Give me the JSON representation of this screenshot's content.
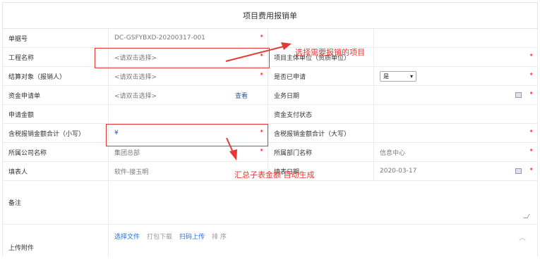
{
  "title": "项目费用报销单",
  "rows": [
    {
      "label": "单据号",
      "value": "DC-GSFYBXD-20200317-001",
      "req": true,
      "label2": "",
      "value2": "",
      "req2": false
    },
    {
      "label": "工程名称",
      "value": "<请双击选择>",
      "req": true,
      "label2": "项目主体单位（资质单位）",
      "value2": "",
      "req2": true
    },
    {
      "label": "结算对象（报销人）",
      "value": "<请双击选择>",
      "req": true,
      "label2": "是否已申请",
      "value2": "",
      "req2": true
    },
    {
      "label": "资金申请单",
      "value": "<请双击选择>",
      "req": false,
      "label2": "业务日期",
      "value2": "",
      "req2": true
    },
    {
      "label": "申请金额",
      "value": "",
      "req": false,
      "label2": "资金支付状态",
      "value2": "",
      "req2": false
    },
    {
      "label": "含税报销金额合计（小写）",
      "value": "¥",
      "req": true,
      "label2": "含税报销金额合计（大写）",
      "value2": "",
      "req2": true
    },
    {
      "label": "所属公司名称",
      "value": "集团总部",
      "req": true,
      "label2": "所属部门名称",
      "value2": "信息中心",
      "req2": true
    },
    {
      "label": "填表人",
      "value": "软件-接玉明",
      "req": false,
      "label2": "填表日期",
      "value2": "2020-03-17",
      "req2": true
    }
  ],
  "view_link": "查看",
  "applied_select": "是",
  "remark_label": "备注",
  "upload_label": "上传附件",
  "upload_buttons": {
    "select": "选择文件",
    "pack": "打包下载",
    "scan": "扫码上传",
    "sort": "排 序"
  },
  "annotations": {
    "a1": "选择需要报销的项目",
    "a2": "汇总子表金额 自动生成"
  },
  "colors": {
    "required": "#e60012",
    "annotation": "#e53935",
    "link": "#2a5caa"
  }
}
